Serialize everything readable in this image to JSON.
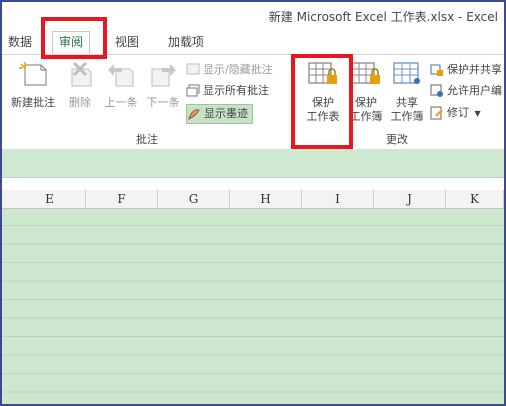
{
  "window": {
    "title": "新建 Microsoft Excel 工作表.xlsx - Excel"
  },
  "tabs": [
    {
      "label": "数据"
    },
    {
      "label": "审阅"
    },
    {
      "label": "视图"
    },
    {
      "label": "加载项"
    }
  ],
  "ribbon": {
    "comments": {
      "new_comment": "新建批注",
      "delete": "删除",
      "previous": "上一条",
      "next": "下一条",
      "show_hide": "显示/隐藏批注",
      "show_all": "显示所有批注",
      "show_ink": "显示墨迹",
      "group_label": "批注"
    },
    "changes": {
      "protect_sheet": [
        "保护",
        "工作表"
      ],
      "protect_workbook": [
        "保护",
        "工作簿"
      ],
      "share_workbook": [
        "共享",
        "工作簿"
      ],
      "protect_share": "保护并共享",
      "allow_users": "允许用户编",
      "track_changes": "修订",
      "group_label": "更改"
    }
  },
  "columns": [
    "E",
    "F",
    "G",
    "H",
    "I",
    "J",
    "K"
  ],
  "colors": {
    "accent": "#217346",
    "highlight": "#e8161f",
    "sheet_bg": "#cde7ce"
  }
}
